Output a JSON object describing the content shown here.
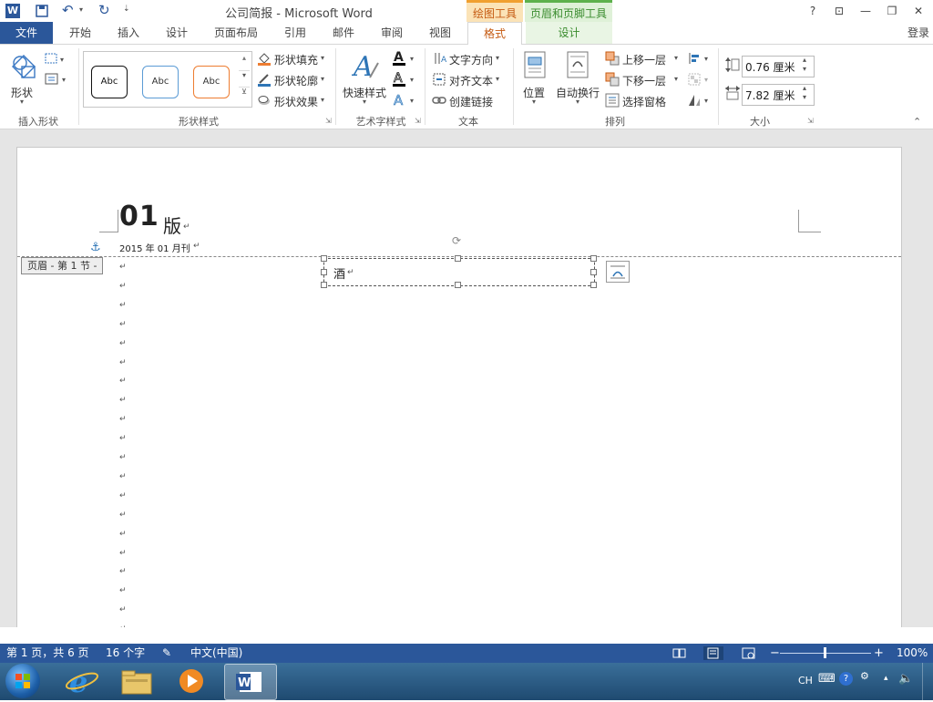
{
  "window": {
    "title": "公司简报 - Microsoft Word",
    "context_tab_groups": [
      "绘图工具",
      "页眉和页脚工具"
    ],
    "buttons": [
      "?",
      "⊡",
      "—",
      "❐",
      "✕"
    ]
  },
  "tabs": {
    "file": "文件",
    "items": [
      "开始",
      "插入",
      "设计",
      "页面布局",
      "引用",
      "邮件",
      "审阅",
      "视图"
    ],
    "format": "格式",
    "hf_design": "设计",
    "signin": "登录"
  },
  "ribbon": {
    "insert_shapes": {
      "shape_label": "形状",
      "group": "插入形状"
    },
    "shape_styles": {
      "abc": [
        "Abc",
        "Abc",
        "Abc"
      ],
      "fill": "形状填充",
      "outline": "形状轮廓",
      "effects": "形状效果",
      "group": "形状样式"
    },
    "wordart": {
      "quick_styles": "快速样式",
      "group": "艺术字样式"
    },
    "text": {
      "direction": "文字方向",
      "align": "对齐文本",
      "link": "创建链接",
      "group": "文本"
    },
    "arrange": {
      "position": "位置",
      "wrap": "自动换行",
      "forward": "上移一层",
      "backward": "下移一层",
      "pane": "选择窗格",
      "group": "排列"
    },
    "size": {
      "height": "0.76 厘米",
      "width": "7.82 厘米",
      "group": "大小"
    }
  },
  "document": {
    "heading_num": "01",
    "heading_suffix": "版",
    "date_line": "2015 年 01 月刊",
    "header_tag": "页眉 - 第 1 节 -",
    "textbox_text": "酒"
  },
  "status": {
    "page": "第 1 页，共 6 页",
    "words": "16 个字",
    "language": "中文(中国)",
    "zoom": "100%"
  },
  "taskbar": {
    "lang": "CH"
  }
}
